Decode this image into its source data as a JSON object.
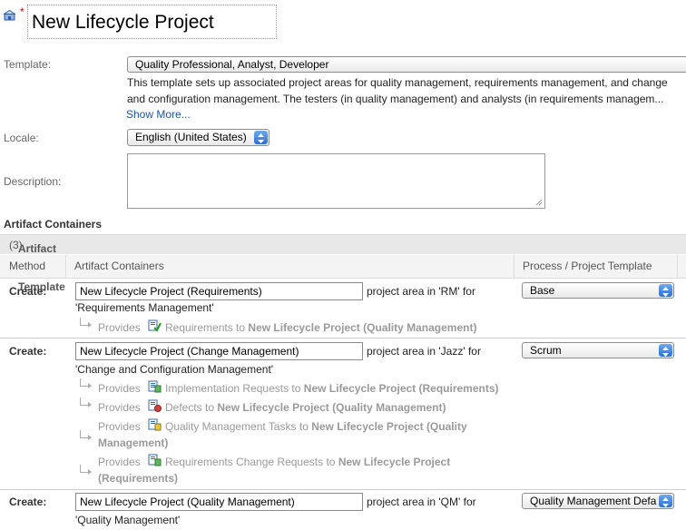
{
  "header": {
    "project_name": "New Lifecycle Project",
    "required_marker": "*"
  },
  "template": {
    "label": "Template:",
    "selected": "Quality Professional, Analyst, Developer",
    "description_line1": "This template sets up associated project areas for quality management, requirements management, and change",
    "description_line2": "and configuration management. The testers (in quality management) and analysts (in requirements managem...",
    "show_more": "Show More..."
  },
  "locale": {
    "label": "Locale:",
    "selected": "English (United States)"
  },
  "description": {
    "label": "Description:",
    "value": ""
  },
  "artifact_containers": {
    "title": "Artifact Containers",
    "subheader": "Artifact Containers for Template",
    "count": "(3)",
    "columns": {
      "method": "Method",
      "containers": "Artifact Containers",
      "process": "Process / Project Template"
    },
    "rows": [
      {
        "method": "Create:",
        "name": "New Lifecycle Project (Requirements)",
        "area_text": "project area in 'RM' for",
        "app_text": "'Requirements Management'",
        "process": "Base",
        "provides": [
          {
            "word": "Provides",
            "kind": "Requirements",
            "to": "to",
            "target": "New Lifecycle Project (Quality Management)",
            "icon": "requirements-icon"
          }
        ]
      },
      {
        "method": "Create:",
        "name": "New Lifecycle Project (Change Management)",
        "area_text": "project area in 'Jazz' for",
        "app_text": "'Change and Configuration Management'",
        "process": "Scrum",
        "provides": [
          {
            "word": "Provides",
            "kind": "Implementation Requests",
            "to": "to",
            "target": "New Lifecycle Project (Requirements)",
            "icon": "implementation-request-icon"
          },
          {
            "word": "Provides",
            "kind": "Defects",
            "to": "to",
            "target": "New Lifecycle Project (Quality Management)",
            "icon": "defect-icon"
          },
          {
            "word": "Provides",
            "kind": "Quality Management Tasks",
            "to": "to",
            "target_a": "New Lifecycle Project (Quality",
            "target_b": "Management)",
            "icon": "qm-task-icon"
          },
          {
            "word": "Provides",
            "kind": "Requirements Change Requests",
            "to": "to",
            "target_a": "New Lifecycle Project",
            "target_b": "(Requirements)",
            "icon": "change-request-icon"
          }
        ]
      },
      {
        "method": "Create:",
        "name": "New Lifecycle Project (Quality Management)",
        "area_text": "project area in 'QM' for",
        "app_text": "'Quality Management'",
        "process": "Quality Management Defa"
      }
    ]
  },
  "colors": {
    "accent": "#2f6fd1",
    "link": "#1a56a8",
    "required": "#cc0000"
  }
}
